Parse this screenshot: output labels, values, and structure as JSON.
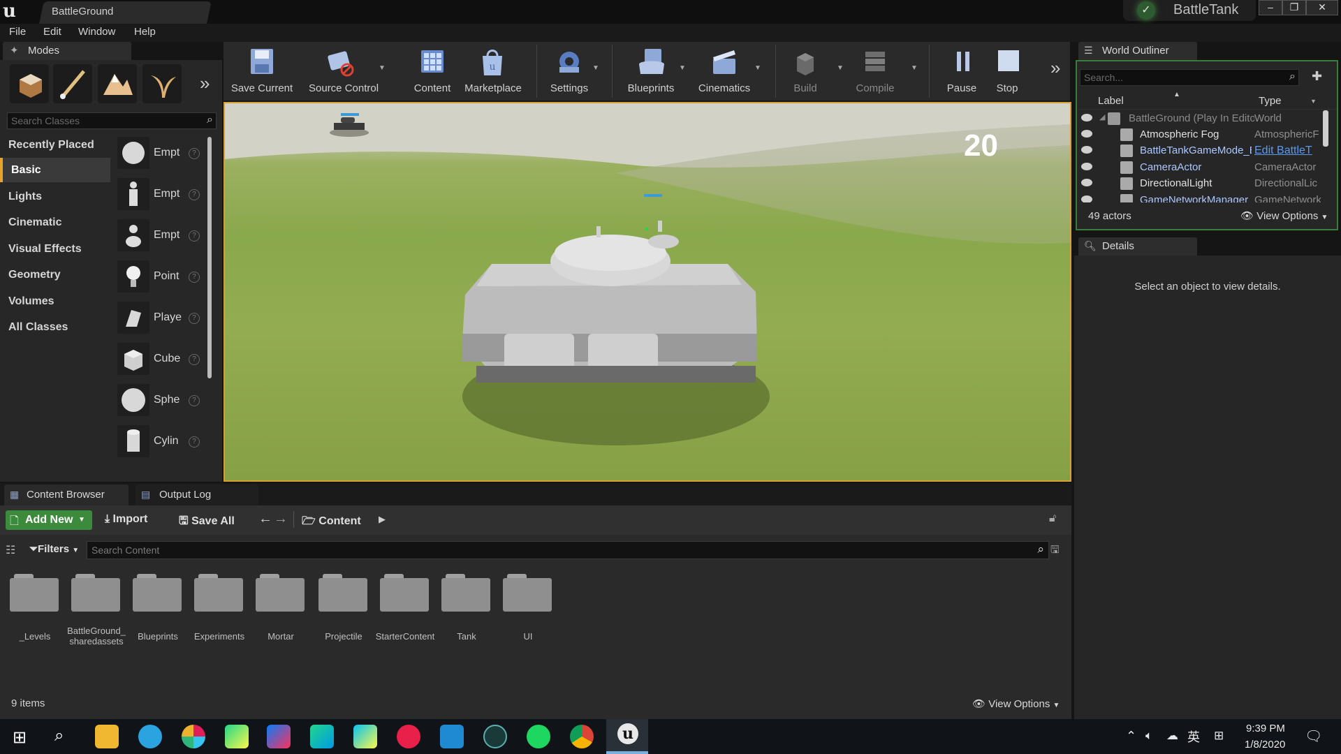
{
  "window": {
    "doc_tab": "BattleGround",
    "project": "BattleTank"
  },
  "menu": [
    "File",
    "Edit",
    "Window",
    "Help"
  ],
  "modes": {
    "tab": "Modes",
    "search_placeholder": "Search Classes",
    "categories": [
      "Recently Placed",
      "Basic",
      "Lights",
      "Cinematic",
      "Visual Effects",
      "Geometry",
      "Volumes",
      "All Classes"
    ],
    "selected_category": "Basic",
    "classes": [
      "Empt",
      "Empt",
      "Empt",
      "Point",
      "Playe",
      "Cube",
      "Sphe",
      "Cylin"
    ]
  },
  "toolbar": {
    "save_current": "Save Current",
    "source_control": "Source Control",
    "content": "Content",
    "marketplace": "Marketplace",
    "settings": "Settings",
    "blueprints": "Blueprints",
    "cinematics": "Cinematics",
    "build": "Build",
    "compile": "Compile",
    "pause": "Pause",
    "stop": "Stop"
  },
  "viewport": {
    "counter": "20"
  },
  "outliner": {
    "tab": "World Outliner",
    "search_placeholder": "Search...",
    "col_label": "Label",
    "col_type": "Type",
    "rows": [
      {
        "label": "BattleGround (Play In Editor)",
        "type": "World"
      },
      {
        "label": "Atmospheric Fog",
        "type": "AtmosphericF"
      },
      {
        "label": "BattleTankGameMode_E",
        "type": "Edit BattleT"
      },
      {
        "label": "CameraActor",
        "type": "CameraActor"
      },
      {
        "label": "DirectionalLight",
        "type": "DirectionalLic"
      },
      {
        "label": "GameNetworkManager",
        "type": "GameNetwork"
      }
    ],
    "count": "49 actors",
    "view_options": "View Options"
  },
  "details": {
    "tab": "Details",
    "empty": "Select an object to view details."
  },
  "content_browser": {
    "tabs": [
      "Content Browser",
      "Output Log"
    ],
    "add_new": "Add New",
    "import": "Import",
    "save_all": "Save All",
    "path": "Content",
    "filters": "Filters",
    "search_placeholder": "Search Content",
    "folders": [
      "_Levels",
      "BattleGround_ sharedassets",
      "Blueprints",
      "Experiments",
      "Mortar",
      "Projectile",
      "StarterContent",
      "Tank",
      "UI"
    ],
    "count": "9 items",
    "view_options": "View Options"
  },
  "taskbar": {
    "time": "9:39 PM",
    "date": "1/8/2020",
    "ime": "英"
  }
}
